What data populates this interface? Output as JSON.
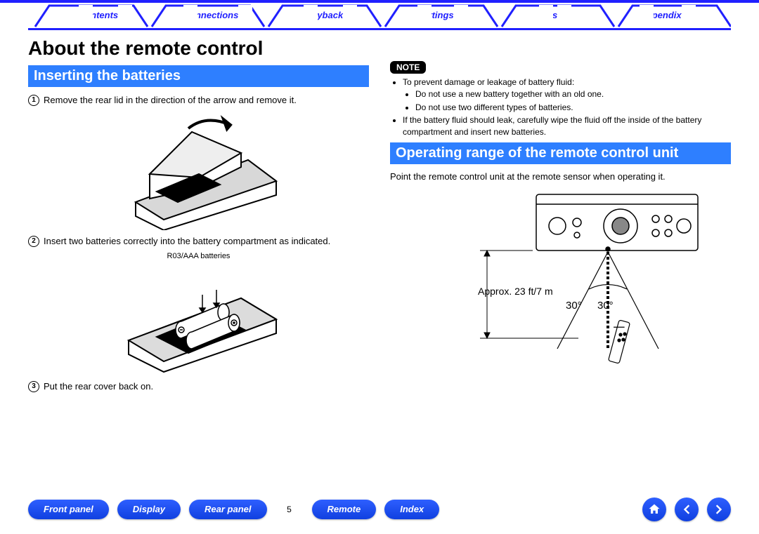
{
  "nav": {
    "tabs": [
      "Contents",
      "Connections",
      "Playback",
      "Settings",
      "Tips",
      "Appendix"
    ]
  },
  "title": "About the remote control",
  "section1": {
    "heading": "Inserting the batteries",
    "step1": "Remove the rear lid in the direction of the arrow and remove it.",
    "step2": "Insert two batteries correctly into the battery compartment as indicated.",
    "battery_label": "R03/AAA batteries",
    "step3": "Put the rear cover back on."
  },
  "note": {
    "label": "NOTE",
    "intro": "To prevent damage or leakage of battery fluid:",
    "b1": "Do not use a new battery together with an old one.",
    "b2": "Do not use two different types of batteries.",
    "tail": "If the battery fluid should leak, carefully wipe the fluid off the inside of the battery compartment and insert new batteries."
  },
  "section2": {
    "heading": "Operating range of the remote control unit",
    "text": "Point the remote control unit at the remote sensor when operating it.",
    "distance": "Approx. 23 ft/7 m",
    "angle_left": "30°",
    "angle_right": "30°"
  },
  "footer": {
    "b1": "Front panel",
    "b2": "Display",
    "b3": "Rear panel",
    "page": "5",
    "b4": "Remote",
    "b5": "Index"
  }
}
